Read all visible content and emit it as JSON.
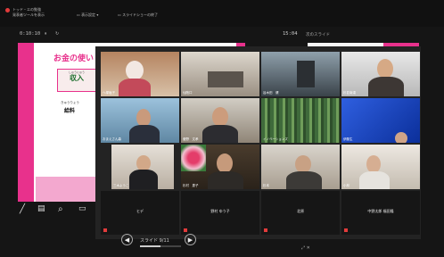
{
  "titlebar": {
    "title": "トッド・エの勉強",
    "subtitle": "発表者ツールを表示",
    "display_menu": "表示設定",
    "end_show": "スライドショーの終了"
  },
  "timer": "0:10:10",
  "clock": "15:04",
  "next_slide_label": "次のスライド",
  "slide": {
    "title": "お金の使い",
    "box_ruby": "しゅうにゅう",
    "box_text": "収入",
    "ruby2": "きゅうりょう",
    "text2": "給料"
  },
  "participants": [
    {
      "name": "ヘ塚塩子"
    },
    {
      "name": "仙陰口"
    },
    {
      "name": "谷木田　健"
    },
    {
      "name": "杉並南達"
    },
    {
      "name": "おまえさん森"
    },
    {
      "name": "菅野　文孝"
    },
    {
      "name": "イノベーションズ"
    },
    {
      "name": "伊藤生"
    },
    {
      "name": "三木ようこ"
    },
    {
      "name": "杉村　恵子"
    },
    {
      "name": "杉本"
    },
    {
      "name": "小林"
    }
  ],
  "name_tiles": [
    "ヒデ",
    "野村 ゆう子",
    "北原",
    "中野太郎 福田隆"
  ],
  "slide_counter": "スライド 9/11",
  "progress_fraction": 0.5,
  "colors": {
    "accent": "#e8318c",
    "rec": "#e23b3b"
  }
}
